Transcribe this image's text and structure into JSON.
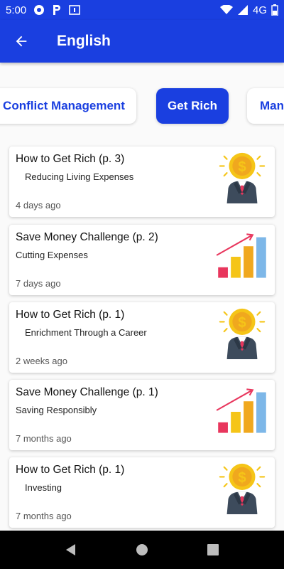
{
  "status_bar": {
    "time": "5:00",
    "network": "4G",
    "icons": [
      "chrome-icon",
      "parking-icon",
      "notification-icon",
      "wifi-icon",
      "signal-icon",
      "battery-icon"
    ]
  },
  "app_bar": {
    "title": "English",
    "back_icon": "arrow-back-icon"
  },
  "categories": [
    {
      "label": "Conflict Management",
      "selected": false
    },
    {
      "label": "Get Rich",
      "selected": true
    },
    {
      "label": "Man",
      "selected": false
    }
  ],
  "lessons": [
    {
      "title": "How to Get Rich (p. 3)",
      "subtitle": "Reducing Living Expenses",
      "time": "4 days ago",
      "image": "businessman-coin-icon"
    },
    {
      "title": "Save Money Challenge (p. 2)",
      "subtitle": "Cutting Expenses",
      "time": "7 days ago",
      "image": "growth-chart-icon"
    },
    {
      "title": "How to Get Rich (p. 1)",
      "subtitle": "Enrichment Through a Career",
      "time": "2 weeks ago",
      "image": "businessman-coin-icon"
    },
    {
      "title": "Save Money Challenge (p. 1)",
      "subtitle": "Saving Responsibly",
      "time": "7 months ago",
      "image": "growth-chart-icon"
    },
    {
      "title": "How to Get Rich (p. 1)",
      "subtitle": "Investing",
      "time": "7 months ago",
      "image": "businessman-coin-icon"
    }
  ],
  "colors": {
    "primary": "#1a3fe0",
    "coin": "#f5c518",
    "chart_arrow": "#e8365d",
    "suit": "#3d4b5c"
  }
}
